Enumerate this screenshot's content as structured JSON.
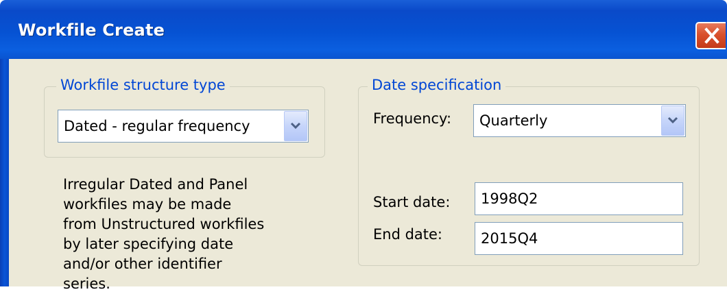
{
  "window": {
    "title": "Workfile Create"
  },
  "structure_group": {
    "title": "Workfile structure type",
    "selected": "Dated - regular frequency"
  },
  "note_text": "Irregular Dated and Panel workfiles may be made from Unstructured workfiles by later specifying date and/or other identifier series.",
  "date_group": {
    "title": "Date specification",
    "frequency_label": "Frequency:",
    "frequency_value": "Quarterly",
    "start_label": "Start date:",
    "start_value": "1998Q2",
    "end_label": "End date:",
    "end_value": "2015Q4"
  },
  "colors": {
    "title_bar": "#0a54d0",
    "close_button": "#d9512d",
    "dialog_background": "#ece9d8",
    "group_title": "#0046d5"
  },
  "icons": {
    "close": "close-icon",
    "dropdown": "chevron-down-icon"
  }
}
